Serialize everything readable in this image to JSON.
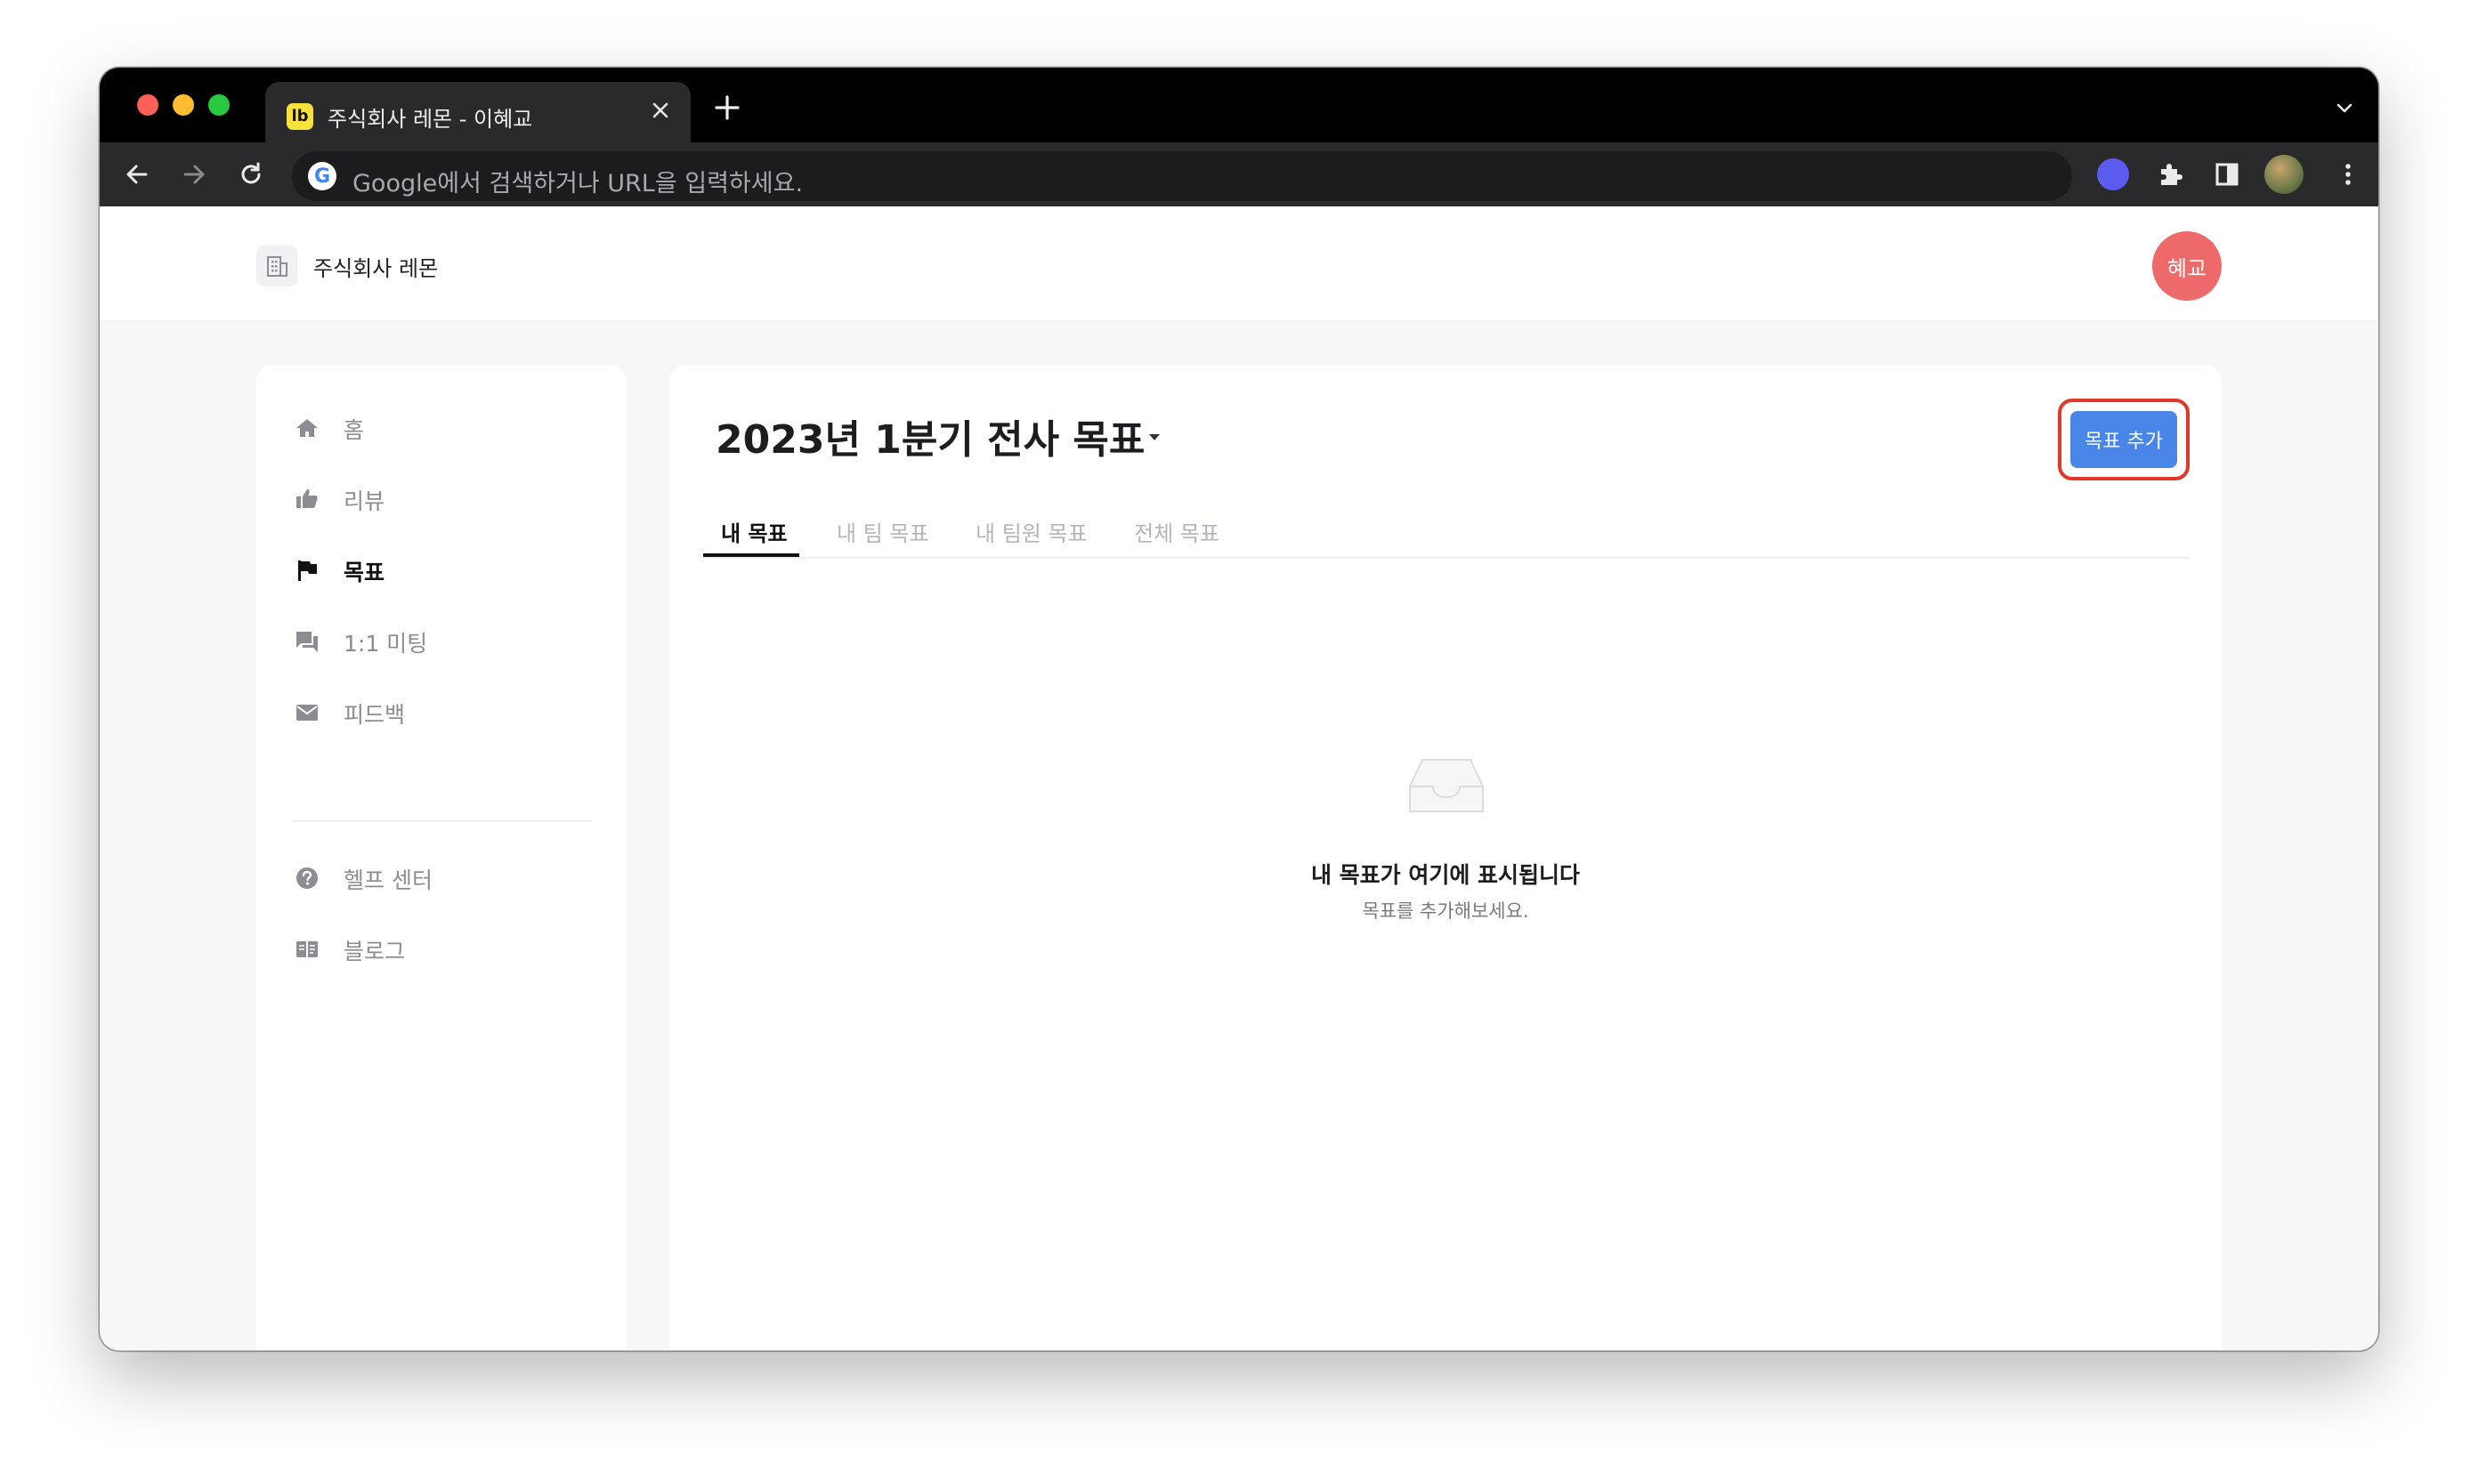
{
  "browser": {
    "tab_favicon": "lb",
    "tab_title": "주식회사 레몬 - 이혜교",
    "omnibox_placeholder": "Google에서 검색하거나 URL을 입력하세요.",
    "omnibox_logo": "G"
  },
  "header": {
    "company_name": "주식회사 레몬",
    "user_initials": "혜교"
  },
  "sidebar": {
    "items": [
      {
        "label": "홈",
        "icon": "home-icon"
      },
      {
        "label": "리뷰",
        "icon": "thumbs-up-icon"
      },
      {
        "label": "목표",
        "icon": "flag-icon",
        "active": true
      },
      {
        "label": "1:1 미팅",
        "icon": "chat-icon"
      },
      {
        "label": "피드백",
        "icon": "mail-icon"
      }
    ],
    "secondary_items": [
      {
        "label": "헬프 센터",
        "icon": "help-icon"
      },
      {
        "label": "블로그",
        "icon": "book-icon"
      }
    ]
  },
  "main": {
    "title": "2023년 1분기 전사 목표",
    "add_button_label": "목표 추가",
    "tabs": [
      {
        "label": "내 목표",
        "active": true
      },
      {
        "label": "내 팀 목표"
      },
      {
        "label": "내 팀원 목표"
      },
      {
        "label": "전체 목표"
      }
    ],
    "empty_state": {
      "title": "내 목표가 여기에 표시됩니다",
      "subtitle": "목표를 추가해보세요."
    }
  },
  "colors": {
    "accent": "#4a86e8",
    "highlight_ring": "#e0382a",
    "avatar": "#ee6a6a"
  }
}
